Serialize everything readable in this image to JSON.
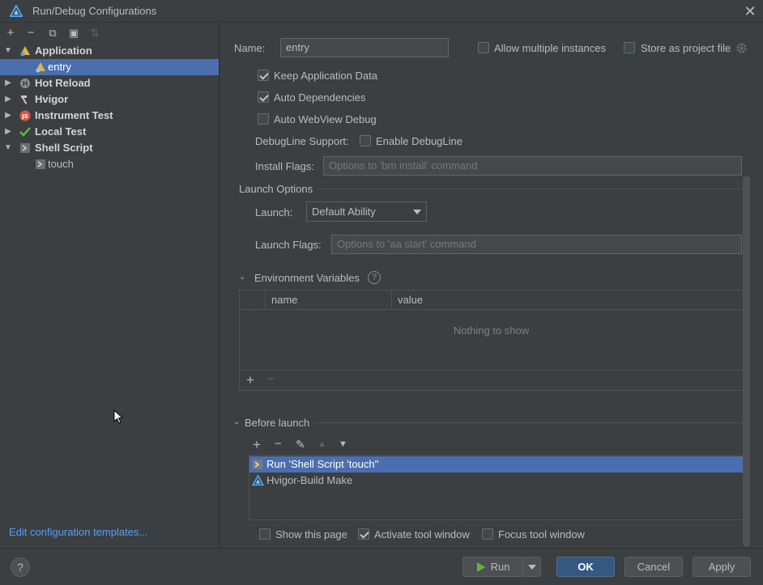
{
  "window": {
    "title": "Run/Debug Configurations",
    "close": "✕"
  },
  "left_toolbar": {
    "add": "+",
    "remove": "−",
    "copy": "⧉",
    "folder": "▣",
    "sort": "⇅"
  },
  "tree": [
    {
      "label": "Application",
      "expanded": true,
      "bold": true
    },
    {
      "label": "entry",
      "selected": true
    },
    {
      "label": "Hot Reload",
      "bold": true
    },
    {
      "label": "Hvigor",
      "bold": true
    },
    {
      "label": "Instrument Test",
      "bold": true
    },
    {
      "label": "Local Test",
      "bold": true
    },
    {
      "label": "Shell Script",
      "expanded": true,
      "bold": true
    },
    {
      "label": "touch"
    }
  ],
  "edit_templates_link": "Edit configuration templates...",
  "form": {
    "name_label": "Name:",
    "name_value": "entry",
    "allow_multiple": "Allow multiple instances",
    "store_project": "Store as project file",
    "keep_app_data": "Keep Application Data",
    "auto_deps": "Auto Dependencies",
    "auto_webview": "Auto WebView Debug",
    "debugline_label": "DebugLine Support:",
    "enable_debugline": "Enable DebugLine",
    "install_flags_label": "Install Flags:",
    "install_flags_placeholder": "Options to 'bm install' command",
    "launch_options": "Launch Options",
    "launch_label": "Launch:",
    "launch_value": "Default Ability",
    "launch_flags_label": "Launch Flags:",
    "launch_flags_placeholder": "Options to 'aa start' command"
  },
  "env": {
    "title": "Environment Variables",
    "help": "?",
    "col_name": "name",
    "col_value": "value",
    "empty": "Nothing to show",
    "add": "+",
    "remove": "−"
  },
  "before_launch": {
    "title": "Before launch",
    "toolbar": {
      "add": "+",
      "remove": "−",
      "edit": "✎",
      "up": "▲",
      "down": "▼"
    },
    "items": [
      "Run 'Shell Script 'touch''",
      "Hvigor-Build Make"
    ]
  },
  "options": {
    "show_page": "Show this page",
    "activate_tool": "Activate tool window",
    "focus_tool": "Focus tool window"
  },
  "buttons": {
    "help": "?",
    "run": "Run",
    "ok": "OK",
    "cancel": "Cancel",
    "apply": "Apply"
  },
  "colors": {
    "accent": "#4b6eaf",
    "link": "#589df6",
    "background": "#3c3f41"
  }
}
